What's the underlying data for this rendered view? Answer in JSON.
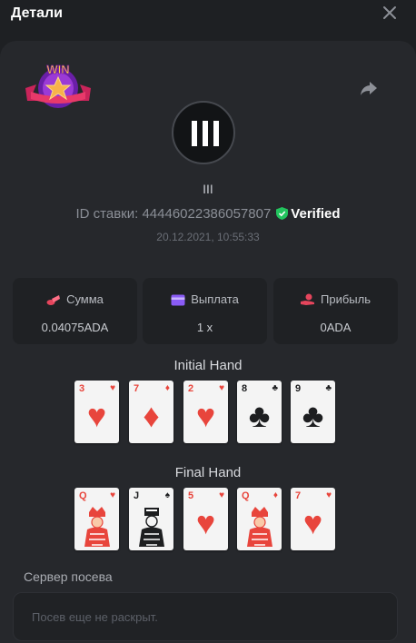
{
  "header": {
    "title": "Детали"
  },
  "logo": {
    "text": "WIN"
  },
  "player": {
    "name": "III"
  },
  "bet": {
    "id_label": "ID ставки:",
    "id_value": "44446022386057807",
    "verified_label": "Verified",
    "datetime": "20.12.2021, 10:55:33"
  },
  "stats": [
    {
      "label": "Сумма",
      "value": "0.04075ADA",
      "icon": "coins-icon",
      "color": "#e5455c"
    },
    {
      "label": "Выплата",
      "value": "1 x",
      "icon": "card-icon",
      "color": "#8a5cf6"
    },
    {
      "label": "Прибыль",
      "value": "0ADA",
      "icon": "hand-coin-icon",
      "color": "#e5455c"
    }
  ],
  "initial_hand": {
    "title": "Initial Hand",
    "cards": [
      {
        "rank": "3",
        "suit": "♥",
        "color": "red"
      },
      {
        "rank": "7",
        "suit": "♦",
        "color": "red"
      },
      {
        "rank": "2",
        "suit": "♥",
        "color": "red"
      },
      {
        "rank": "8",
        "suit": "♣",
        "color": "black"
      },
      {
        "rank": "9",
        "suit": "♣",
        "color": "black"
      }
    ]
  },
  "final_hand": {
    "title": "Final Hand",
    "cards": [
      {
        "rank": "Q",
        "suit": "♥",
        "color": "red",
        "face": true
      },
      {
        "rank": "J",
        "suit": "♠",
        "color": "black",
        "face": true
      },
      {
        "rank": "5",
        "suit": "♥",
        "color": "red"
      },
      {
        "rank": "Q",
        "suit": "♦",
        "color": "red",
        "face": true
      },
      {
        "rank": "7",
        "suit": "♥",
        "color": "red"
      }
    ]
  },
  "seed": {
    "label": "Сервер посева",
    "value": "Посев еще не раскрыт."
  },
  "colors": {
    "verified": "#22c55e",
    "panel": "#26282c"
  }
}
